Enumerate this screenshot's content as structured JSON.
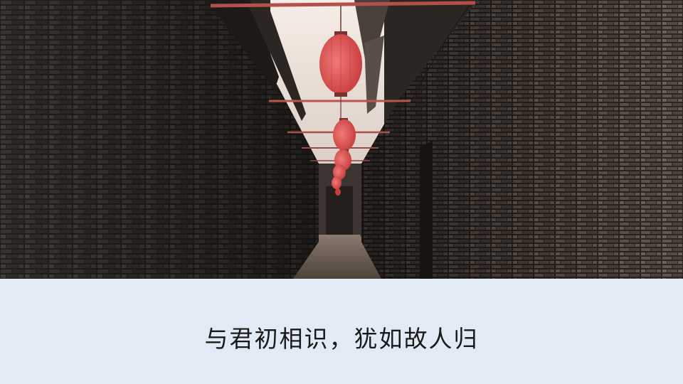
{
  "caption": "与君初相识，犹如故人归",
  "colors": {
    "band": "#e1eaf5",
    "lantern": "#e05b5c",
    "brick_dark": "#2a2622",
    "sky": "#f2e8e0"
  },
  "photo_subject": "narrow-brick-alley-with-red-lanterns"
}
